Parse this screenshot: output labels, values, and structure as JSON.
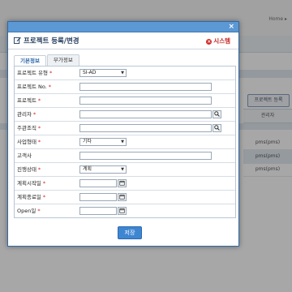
{
  "background": {
    "breadcrumb": "Home  ▸",
    "project_register_button": "프로젝트 등록",
    "column_header": "관리자",
    "rows": [
      "pms(pms)",
      "pms(pms)",
      "pms(pms)"
    ]
  },
  "dialog": {
    "close_label": "×",
    "title": "프로젝트 등록/변경",
    "system_label": "시스템",
    "tabs": [
      {
        "label": "기본정보",
        "active": true
      },
      {
        "label": "부가정보",
        "active": false
      }
    ],
    "fields": [
      {
        "label": "프로젝트 유형",
        "required": true,
        "type": "select",
        "value": "SI-AD"
      },
      {
        "label": "프로젝트 No.",
        "required": true,
        "type": "text",
        "value": ""
      },
      {
        "label": "프로젝트",
        "required": true,
        "type": "text",
        "value": ""
      },
      {
        "label": "관리자",
        "required": true,
        "type": "search",
        "value": ""
      },
      {
        "label": "주관조직",
        "required": true,
        "type": "search",
        "value": ""
      },
      {
        "label": "사업형태",
        "required": true,
        "type": "select",
        "value": "기타"
      },
      {
        "label": "고객사",
        "required": false,
        "type": "text",
        "value": ""
      },
      {
        "label": "진행상태",
        "required": true,
        "type": "select",
        "value": "계획"
      },
      {
        "label": "계획시작일",
        "required": true,
        "type": "date",
        "value": ""
      },
      {
        "label": "계획종료일",
        "required": true,
        "type": "date",
        "value": ""
      },
      {
        "label": "Open일",
        "required": true,
        "type": "date",
        "value": ""
      }
    ],
    "save_label": "저장"
  },
  "icons": {
    "search": "search-icon",
    "calendar": "calendar-icon",
    "edit": "edit-icon"
  }
}
